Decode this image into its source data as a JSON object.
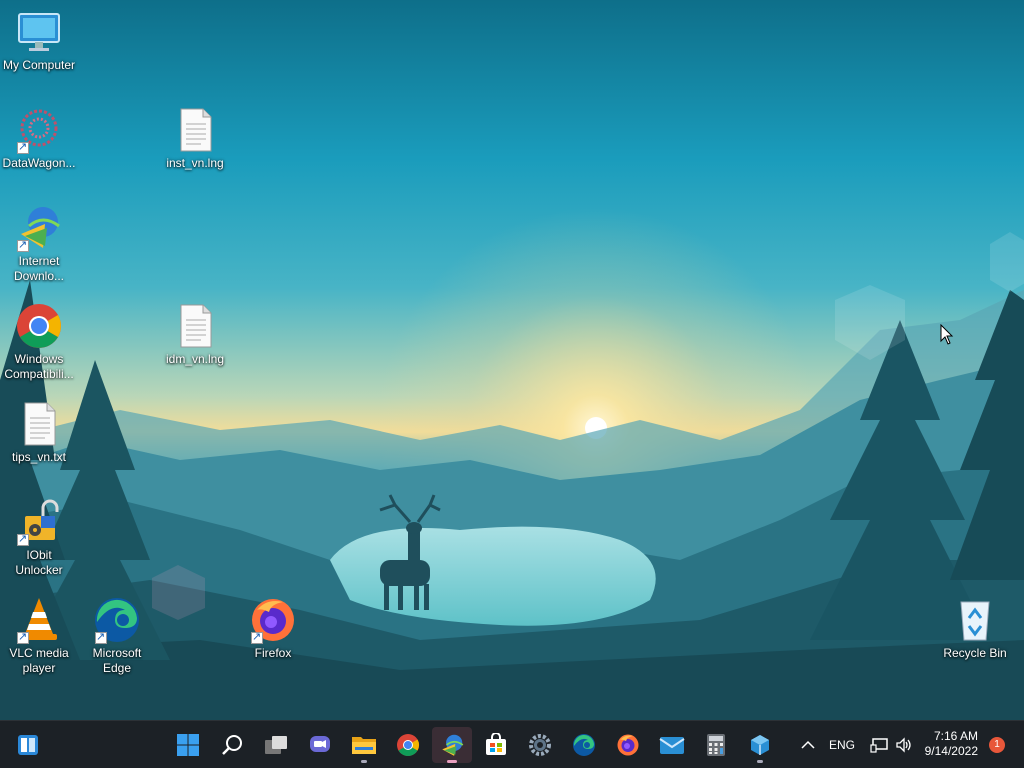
{
  "desktop": {
    "icons": [
      {
        "label": "My Computer"
      },
      {
        "label": "DataWagon..."
      },
      {
        "label": "inst_vn.lng"
      },
      {
        "label": "Internet Downlo..."
      },
      {
        "label": "Windows Compatibili..."
      },
      {
        "label": "idm_vn.lng"
      },
      {
        "label": "tips_vn.txt"
      },
      {
        "label": "IObit Unlocker"
      },
      {
        "label": "VLC media player"
      },
      {
        "label": "Microsoft Edge"
      },
      {
        "label": "Firefox"
      },
      {
        "label": "Recycle Bin"
      }
    ]
  },
  "taskbar": {
    "pinned": [
      {
        "icon": "windows-start-icon"
      },
      {
        "icon": "search-icon"
      },
      {
        "icon": "task-view-icon"
      },
      {
        "icon": "chat-icon"
      },
      {
        "icon": "file-explorer-icon"
      },
      {
        "icon": "chrome-icon"
      },
      {
        "icon": "idm-icon"
      },
      {
        "icon": "store-icon"
      },
      {
        "icon": "settings-icon"
      },
      {
        "icon": "edge-icon"
      },
      {
        "icon": "firefox-icon"
      },
      {
        "icon": "mail-icon"
      },
      {
        "icon": "calculator-icon"
      },
      {
        "icon": "app-cube-icon"
      }
    ],
    "tray": {
      "language": "ENG",
      "time": "7:16 AM",
      "date": "9/14/2022",
      "notification_count": "1"
    }
  }
}
